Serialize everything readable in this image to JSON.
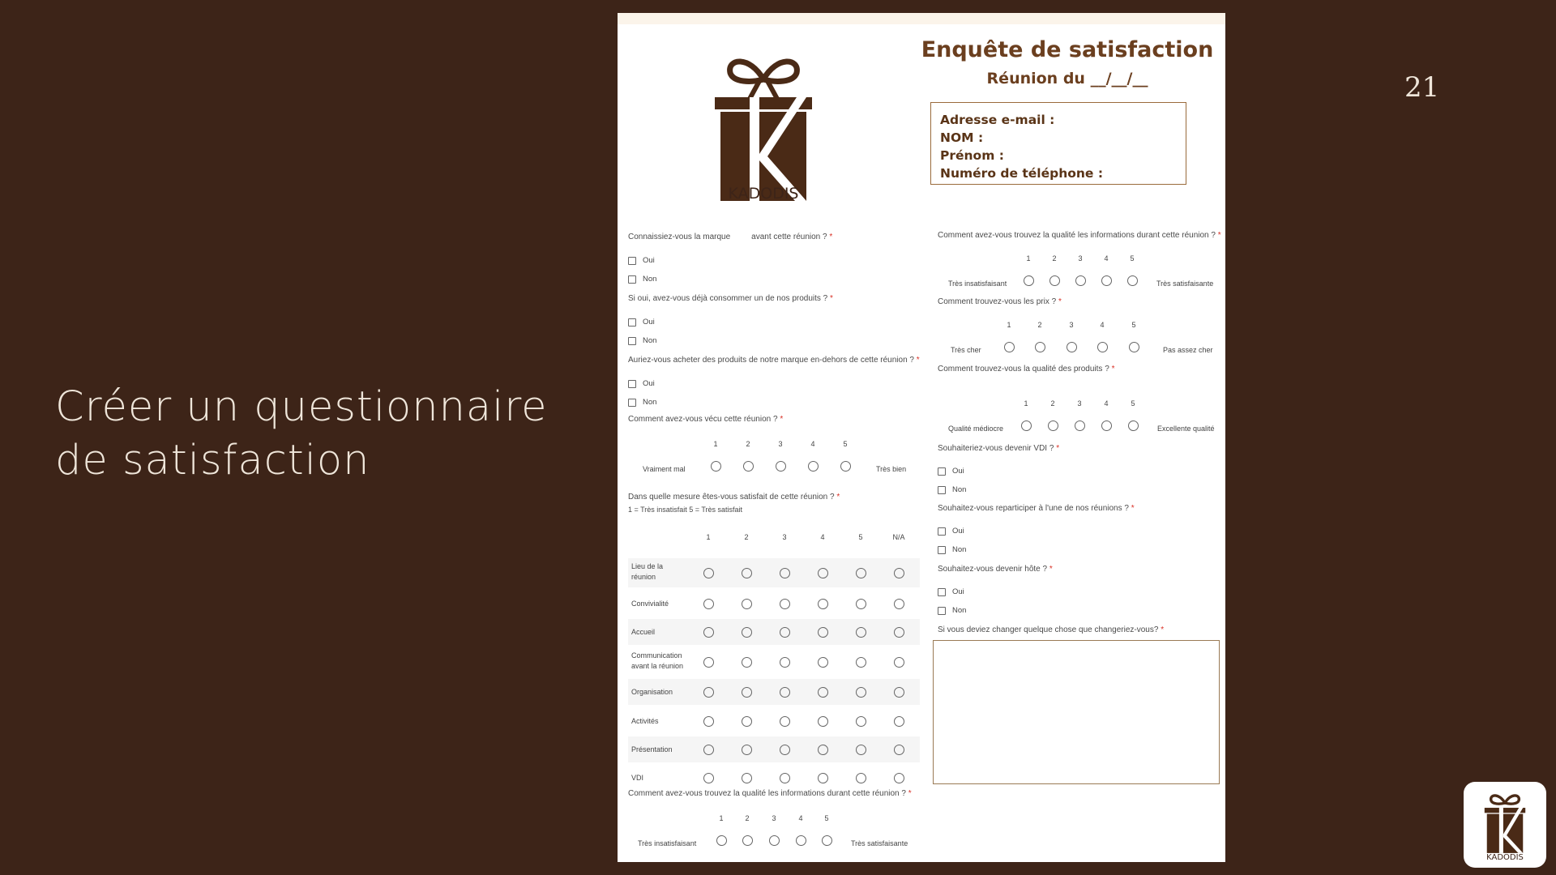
{
  "slide": {
    "title_line1": "Créer un questionnaire",
    "title_line2": "de satisfaction",
    "page_number": "21"
  },
  "brand": {
    "name": "KADODIS",
    "colors": {
      "primary": "#4a2a16",
      "background": "#3d2418",
      "accent": "#6b3f1f"
    }
  },
  "form": {
    "heading": "Enquête de satisfaction",
    "subheading": "Réunion du __/__/__",
    "info_fields": [
      "Adresse e-mail :",
      "NOM :",
      "Prénom :",
      "Numéro de téléphone :"
    ],
    "required_mark": "*",
    "yes": "Oui",
    "no": "Non",
    "scale": [
      "1",
      "2",
      "3",
      "4",
      "5"
    ],
    "left": {
      "q1": {
        "text_a": "Connaissiez-vous la marque",
        "text_b": "avant cette réunion ?"
      },
      "q2": {
        "text": "Si oui, avez-vous déjà consommer un de nos produits ?"
      },
      "q3": {
        "text": "Auriez-vous acheter des produits de notre marque en-dehors de cette réunion ?"
      },
      "q4": {
        "text": "Comment avez-vous vécu cette réunion ?",
        "low": "Vraiment mal",
        "high": "Très bien"
      },
      "grid": {
        "question": "Dans quelle mesure êtes-vous satisfait de cette réunion ?",
        "hint": "1 = Très insatisfait 5 = Très satisfait",
        "columns": [
          "1",
          "2",
          "3",
          "4",
          "5",
          "N/A"
        ],
        "rows": [
          {
            "line1": "Lieu de la",
            "line2": "réunion"
          },
          {
            "line1": "Convivialité",
            "line2": ""
          },
          {
            "line1": "Accueil",
            "line2": ""
          },
          {
            "line1": "Communication",
            "line2": "avant la réunion"
          },
          {
            "line1": "Organisation",
            "line2": ""
          },
          {
            "line1": "Activités",
            "line2": ""
          },
          {
            "line1": "Présentation",
            "line2": ""
          },
          {
            "line1": "VDI",
            "line2": ""
          }
        ]
      },
      "q6": {
        "text": "Comment avez-vous trouvez la qualité les informations durant cette réunion ?",
        "low": "Très insatisfaisant",
        "high": "Très satisfaisante"
      }
    },
    "right": {
      "r1": {
        "text": "Comment avez-vous trouvez la qualité les informations durant cette réunion ?",
        "low": "Très insatisfaisant",
        "high": "Très satisfaisante"
      },
      "r2": {
        "text": "Comment trouvez-vous les prix ?",
        "low": "Très cher",
        "high": "Pas assez cher"
      },
      "r3": {
        "text": "Comment trouvez-vous la qualité des produits ?",
        "low": "Qualité médiocre",
        "high": "Excellente qualité"
      },
      "r4": {
        "text": "Souhaiteriez-vous devenir VDI ?"
      },
      "r5": {
        "text": "Souhaitez-vous reparticiper à l'une de nos réunions ?"
      },
      "r6": {
        "text": "Souhaitez-vous devenir hôte ?"
      },
      "r7": {
        "text": "Si vous deviez changer quelque chose que changeriez-vous?"
      }
    }
  }
}
